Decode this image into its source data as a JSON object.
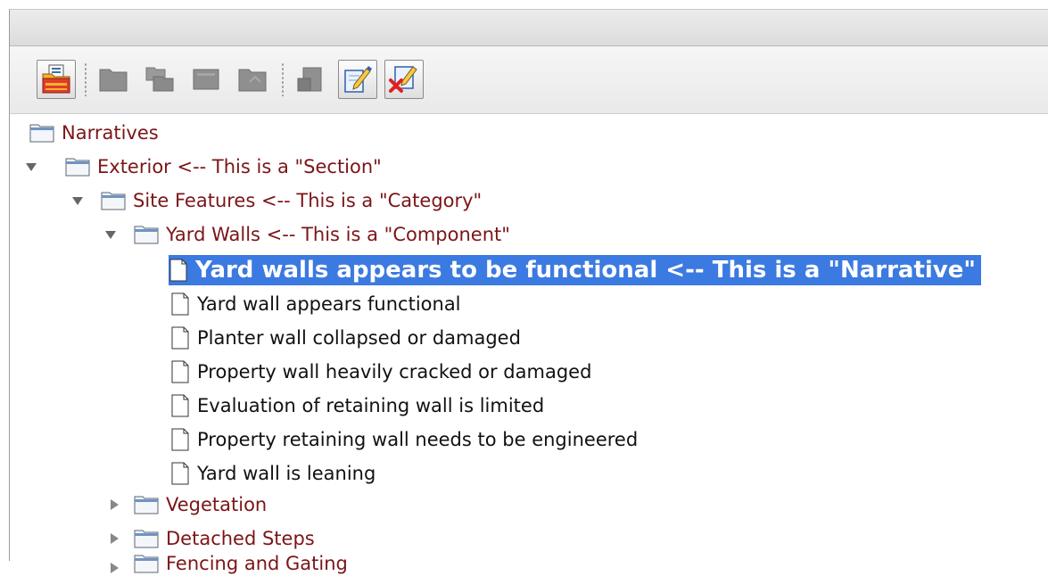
{
  "toolbar": {
    "buttons": [
      {
        "name": "add-item-button",
        "icon": "folder-with-document-icon",
        "enabled": true
      },
      {
        "name": "new-section-button",
        "icon": "folder-icon",
        "enabled": false
      },
      {
        "name": "new-category-button",
        "icon": "folders-icon",
        "enabled": false
      },
      {
        "name": "new-component-button",
        "icon": "folder-icon",
        "enabled": false
      },
      {
        "name": "open-folder-button",
        "icon": "folder-open-icon",
        "enabled": false
      },
      {
        "name": "edit-disabled-button",
        "icon": "document-icon",
        "enabled": false
      },
      {
        "name": "edit-narrative-button",
        "icon": "document-pen-icon",
        "enabled": true
      },
      {
        "name": "delete-narrative-button",
        "icon": "document-delete-icon",
        "enabled": true
      }
    ]
  },
  "tree": {
    "root": {
      "label": "Narratives"
    },
    "section": {
      "label": "Exterior  <-- This is a \"Section\"",
      "expanded": true
    },
    "category": {
      "label": "Site Features  <-- This is a \"Category\"",
      "expanded": true
    },
    "component": {
      "label": "Yard Walls  <-- This is a \"Component\"",
      "expanded": true
    },
    "narratives": [
      {
        "label": "Yard walls appears to be functional  <-- This is a \"Narrative\"",
        "selected": true
      },
      {
        "label": "Yard wall appears functional"
      },
      {
        "label": "Planter wall collapsed or damaged"
      },
      {
        "label": "Property wall heavily cracked or damaged"
      },
      {
        "label": "Evaluation of retaining wall is limited"
      },
      {
        "label": "Property retaining wall needs to be engineered"
      },
      {
        "label": "Yard wall is leaning"
      }
    ],
    "sibling_components": [
      {
        "label": "Vegetation",
        "expanded": false
      },
      {
        "label": "Detached Steps",
        "expanded": false
      },
      {
        "label": "Fencing and Gating",
        "expanded": false
      }
    ]
  },
  "colors": {
    "folder_label": "#7b1518",
    "selection": "#3b7ae0"
  }
}
